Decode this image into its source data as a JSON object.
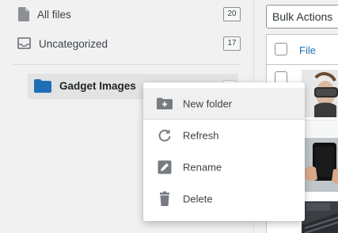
{
  "sidebar": {
    "all_files": {
      "label": "All files",
      "count": "20",
      "icon": "file-icon"
    },
    "uncategorized": {
      "label": "Uncategorized",
      "count": "17",
      "icon": "inbox-icon"
    },
    "folders": [
      {
        "label": "Gadget Images",
        "icon": "folder-icon",
        "color": "#1e6fb5"
      }
    ]
  },
  "main": {
    "bulk_actions": "Bulk Actions",
    "table": {
      "column_file": "File"
    }
  },
  "context_menu": {
    "items": [
      {
        "label": "New folder",
        "icon": "folder-plus-icon"
      },
      {
        "label": "Refresh",
        "icon": "refresh-icon"
      },
      {
        "label": "Rename",
        "icon": "pencil-icon"
      },
      {
        "label": "Delete",
        "icon": "trash-icon"
      }
    ]
  },
  "colors": {
    "link": "#2271b1",
    "folder": "#1e6fb5",
    "icon_gray": "#787c82"
  }
}
